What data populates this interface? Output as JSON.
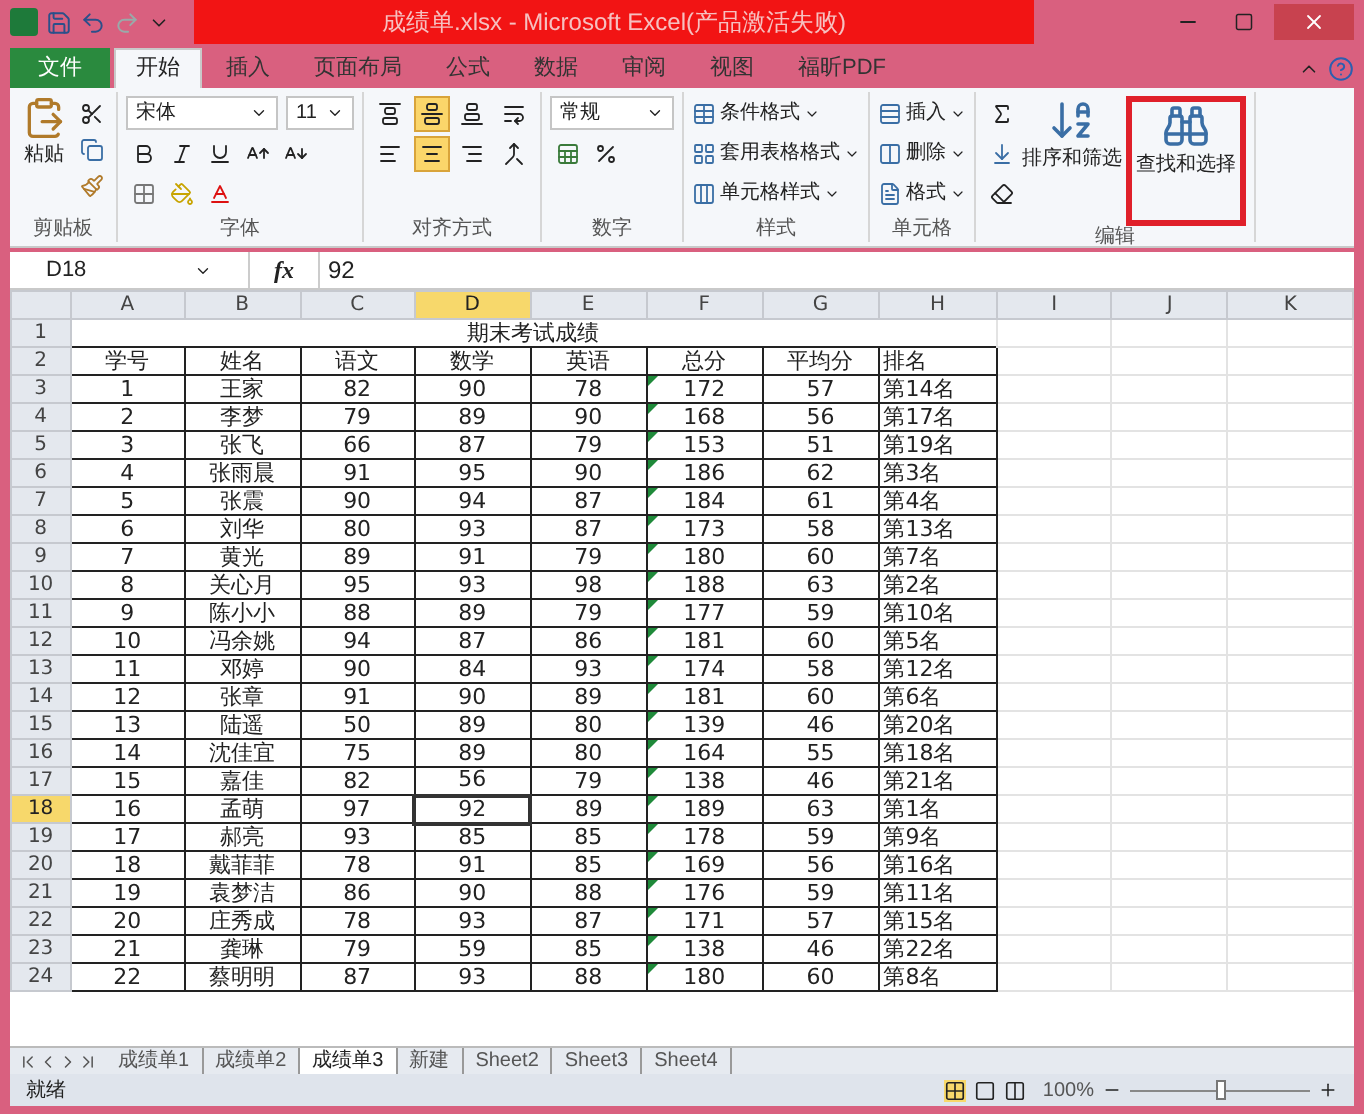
{
  "window": {
    "title": "成绩单.xlsx - Microsoft Excel(产品激活失败)",
    "title_highlighted": true
  },
  "tabs": [
    {
      "label": "文件",
      "kind": "file",
      "selected": false
    },
    {
      "label": "开始",
      "kind": "tab",
      "selected": true
    },
    {
      "label": "插入",
      "kind": "tab",
      "selected": false
    },
    {
      "label": "页面布局",
      "kind": "tab",
      "selected": false
    },
    {
      "label": "公式",
      "kind": "tab",
      "selected": false
    },
    {
      "label": "数据",
      "kind": "tab",
      "selected": false
    },
    {
      "label": "审阅",
      "kind": "tab",
      "selected": false
    },
    {
      "label": "视图",
      "kind": "tab",
      "selected": false
    },
    {
      "label": "福昕PDF",
      "kind": "tab",
      "selected": false
    }
  ],
  "ribbon": {
    "groups": [
      {
        "kind": "clipboard",
        "label": "剪贴板",
        "paste": "粘贴"
      },
      {
        "kind": "font",
        "label": "字体",
        "font_name": "宋体",
        "font_size": "11"
      },
      {
        "kind": "alignment",
        "label": "对齐方式",
        "buttons": [
          {
            "kind": "top",
            "selected": false
          },
          {
            "kind": "middle",
            "selected": true
          },
          {
            "kind": "bottom",
            "selected": false
          },
          {
            "kind": "wrap",
            "selected": false
          },
          {
            "kind": "left",
            "selected": false
          },
          {
            "kind": "center",
            "selected": true
          },
          {
            "kind": "right",
            "selected": false
          },
          {
            "kind": "merge",
            "selected": false
          }
        ]
      },
      {
        "kind": "number",
        "label": "数字",
        "format": "常规"
      },
      {
        "kind": "styles",
        "label": "样式",
        "items": [
          "条件格式",
          "套用表格格式",
          "单元格样式"
        ]
      },
      {
        "kind": "cells",
        "label": "单元格",
        "items": [
          "插入",
          "删除",
          "格式"
        ]
      },
      {
        "kind": "editing",
        "label": "编辑",
        "sort": "排序和筛选",
        "find": "查找和选择",
        "find_highlighted": true
      }
    ]
  },
  "formula_bar": {
    "name_box": "D18",
    "function_label": "fx",
    "value": "92"
  },
  "sheet": {
    "columns": [
      {
        "label": "A",
        "selected": false,
        "error_marks": false
      },
      {
        "label": "B",
        "selected": false,
        "error_marks": false
      },
      {
        "label": "C",
        "selected": false,
        "error_marks": false
      },
      {
        "label": "D",
        "selected": true,
        "error_marks": false
      },
      {
        "label": "E",
        "selected": false,
        "error_marks": false
      },
      {
        "label": "F",
        "selected": false,
        "error_marks": true
      },
      {
        "label": "G",
        "selected": false,
        "error_marks": false
      },
      {
        "label": "H",
        "selected": false,
        "error_marks": false
      },
      {
        "label": "I",
        "selected": false,
        "error_marks": false
      },
      {
        "label": "J",
        "selected": false,
        "error_marks": false
      },
      {
        "label": "K",
        "selected": false,
        "error_marks": false
      }
    ],
    "title_row": {
      "number": "1",
      "title": "期末考试成绩"
    },
    "header_row": {
      "number": "2",
      "cells": [
        "学号",
        "姓名",
        "语文",
        "数学",
        "英语",
        "总分",
        "平均分",
        "排名"
      ]
    },
    "rows": [
      {
        "number": "3",
        "selected": false,
        "cells": [
          "1",
          "王家",
          "82",
          "90",
          "78",
          "172",
          "57",
          "第14名"
        ]
      },
      {
        "number": "4",
        "selected": false,
        "cells": [
          "2",
          "李梦",
          "79",
          "89",
          "90",
          "168",
          "56",
          "第17名"
        ]
      },
      {
        "number": "5",
        "selected": false,
        "cells": [
          "3",
          "张飞",
          "66",
          "87",
          "79",
          "153",
          "51",
          "第19名"
        ]
      },
      {
        "number": "6",
        "selected": false,
        "cells": [
          "4",
          "张雨晨",
          "91",
          "95",
          "90",
          "186",
          "62",
          "第3名"
        ]
      },
      {
        "number": "7",
        "selected": false,
        "cells": [
          "5",
          "张震",
          "90",
          "94",
          "87",
          "184",
          "61",
          "第4名"
        ]
      },
      {
        "number": "8",
        "selected": false,
        "cells": [
          "6",
          "刘华",
          "80",
          "93",
          "87",
          "173",
          "58",
          "第13名"
        ]
      },
      {
        "number": "9",
        "selected": false,
        "cells": [
          "7",
          "黄光",
          "89",
          "91",
          "79",
          "180",
          "60",
          "第7名"
        ]
      },
      {
        "number": "10",
        "selected": false,
        "cells": [
          "8",
          "关心月",
          "95",
          "93",
          "98",
          "188",
          "63",
          "第2名"
        ]
      },
      {
        "number": "11",
        "selected": false,
        "cells": [
          "9",
          "陈小小",
          "88",
          "89",
          "79",
          "177",
          "59",
          "第10名"
        ]
      },
      {
        "number": "12",
        "selected": false,
        "cells": [
          "10",
          "冯余姚",
          "94",
          "87",
          "86",
          "181",
          "60",
          "第5名"
        ]
      },
      {
        "number": "13",
        "selected": false,
        "cells": [
          "11",
          "邓婷",
          "90",
          "84",
          "93",
          "174",
          "58",
          "第12名"
        ]
      },
      {
        "number": "14",
        "selected": false,
        "cells": [
          "12",
          "张章",
          "91",
          "90",
          "89",
          "181",
          "60",
          "第6名"
        ]
      },
      {
        "number": "15",
        "selected": false,
        "cells": [
          "13",
          "陆遥",
          "50",
          "89",
          "80",
          "139",
          "46",
          "第20名"
        ]
      },
      {
        "number": "16",
        "selected": false,
        "cells": [
          "14",
          "沈佳宜",
          "75",
          "89",
          "80",
          "164",
          "55",
          "第18名"
        ]
      },
      {
        "number": "17",
        "selected": false,
        "cells": [
          "15",
          "嘉佳",
          "82",
          "56",
          "79",
          "138",
          "46",
          "第21名"
        ]
      },
      {
        "number": "18",
        "selected": true,
        "cells": [
          "16",
          "孟萌",
          "97",
          "92",
          "89",
          "189",
          "63",
          "第1名"
        ]
      },
      {
        "number": "19",
        "selected": false,
        "cells": [
          "17",
          "郝亮",
          "93",
          "85",
          "85",
          "178",
          "59",
          "第9名"
        ]
      },
      {
        "number": "20",
        "selected": false,
        "cells": [
          "18",
          "戴菲菲",
          "78",
          "91",
          "85",
          "169",
          "56",
          "第16名"
        ]
      },
      {
        "number": "21",
        "selected": false,
        "cells": [
          "19",
          "袁梦洁",
          "86",
          "90",
          "88",
          "176",
          "59",
          "第11名"
        ]
      },
      {
        "number": "22",
        "selected": false,
        "cells": [
          "20",
          "庄秀成",
          "78",
          "93",
          "87",
          "171",
          "57",
          "第15名"
        ]
      },
      {
        "number": "23",
        "selected": false,
        "cells": [
          "21",
          "龚琳",
          "79",
          "59",
          "85",
          "138",
          "46",
          "第22名"
        ]
      },
      {
        "number": "24",
        "selected": false,
        "cells": [
          "22",
          "蔡明明",
          "87",
          "93",
          "88",
          "180",
          "60",
          "第8名"
        ]
      }
    ]
  },
  "sheet_tabs": [
    {
      "label": "成绩单1",
      "selected": false
    },
    {
      "label": "成绩单2",
      "selected": false
    },
    {
      "label": "成绩单3",
      "selected": true
    },
    {
      "label": "新建",
      "selected": false
    },
    {
      "label": "Sheet2",
      "selected": false
    },
    {
      "label": "Sheet3",
      "selected": false
    },
    {
      "label": "Sheet4",
      "selected": false
    }
  ],
  "status_bar": {
    "status": "就绪",
    "zoom": "100%",
    "zoom_slider": {
      "level": 0.5
    }
  }
}
